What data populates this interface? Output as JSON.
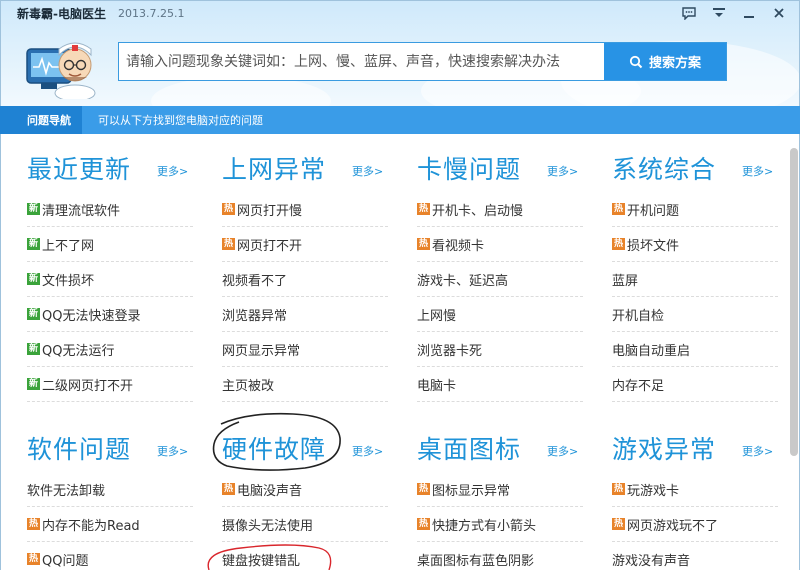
{
  "window": {
    "title": "新毒霸-电脑医生",
    "version": "2013.7.25.1",
    "controls": [
      "feedback-icon",
      "menu-icon",
      "minimize-icon",
      "close-icon"
    ]
  },
  "search": {
    "placeholder": "请输入问题现象关键词如：上网、慢、蓝屏、声音，快速搜索解决办法",
    "value": "",
    "button_label": "搜索方案"
  },
  "nav": {
    "tab_label": "问题导航",
    "description": "可以从下方找到您电脑对应的问题"
  },
  "colors": {
    "accent": "#1f93d8",
    "nav_bar": "#3a9ce8",
    "new_tag": "#3aa33a",
    "hot_tag": "#e8832a",
    "annotation": "#222222",
    "annotation_red": "#d9262c"
  },
  "tag_labels": {
    "new": "新",
    "hot": "热"
  },
  "more_label": "更多>",
  "categories": [
    {
      "title": "最近更新",
      "items": [
        {
          "text": "清理流氓软件",
          "tag": "new"
        },
        {
          "text": "上不了网",
          "tag": "new"
        },
        {
          "text": "文件损坏",
          "tag": "new"
        },
        {
          "text": "QQ无法快速登录",
          "tag": "new"
        },
        {
          "text": "QQ无法运行",
          "tag": "new"
        },
        {
          "text": "二级网页打不开",
          "tag": "new"
        }
      ]
    },
    {
      "title": "上网异常",
      "items": [
        {
          "text": "网页打开慢",
          "tag": "hot"
        },
        {
          "text": "网页打不开",
          "tag": "hot"
        },
        {
          "text": "视频看不了",
          "tag": ""
        },
        {
          "text": "浏览器异常",
          "tag": ""
        },
        {
          "text": "网页显示异常",
          "tag": ""
        },
        {
          "text": "主页被改",
          "tag": ""
        }
      ]
    },
    {
      "title": "卡慢问题",
      "items": [
        {
          "text": "开机卡、启动慢",
          "tag": "hot"
        },
        {
          "text": "看视频卡",
          "tag": "hot"
        },
        {
          "text": "游戏卡、延迟高",
          "tag": ""
        },
        {
          "text": "上网慢",
          "tag": ""
        },
        {
          "text": "浏览器卡死",
          "tag": ""
        },
        {
          "text": "电脑卡",
          "tag": ""
        }
      ]
    },
    {
      "title": "系统综合",
      "items": [
        {
          "text": "开机问题",
          "tag": "hot"
        },
        {
          "text": "损坏文件",
          "tag": "hot"
        },
        {
          "text": "蓝屏",
          "tag": ""
        },
        {
          "text": "开机自检",
          "tag": ""
        },
        {
          "text": "电脑自动重启",
          "tag": ""
        },
        {
          "text": "内存不足",
          "tag": ""
        }
      ]
    },
    {
      "title": "软件问题",
      "items": [
        {
          "text": "软件无法卸载",
          "tag": ""
        },
        {
          "text": "内存不能为Read",
          "tag": "hot"
        },
        {
          "text": "QQ问题",
          "tag": "hot"
        }
      ]
    },
    {
      "title": "硬件故障",
      "items": [
        {
          "text": "电脑没声音",
          "tag": "hot"
        },
        {
          "text": "摄像头无法使用",
          "tag": ""
        },
        {
          "text": "键盘按键错乱",
          "tag": ""
        }
      ]
    },
    {
      "title": "桌面图标",
      "items": [
        {
          "text": "图标显示异常",
          "tag": "hot"
        },
        {
          "text": "快捷方式有小箭头",
          "tag": "hot"
        },
        {
          "text": "桌面图标有蓝色阴影",
          "tag": ""
        }
      ]
    },
    {
      "title": "游戏异常",
      "items": [
        {
          "text": "玩游戏卡",
          "tag": "hot"
        },
        {
          "text": "网页游戏玩不了",
          "tag": "hot"
        },
        {
          "text": "游戏没有声音",
          "tag": ""
        }
      ]
    }
  ]
}
